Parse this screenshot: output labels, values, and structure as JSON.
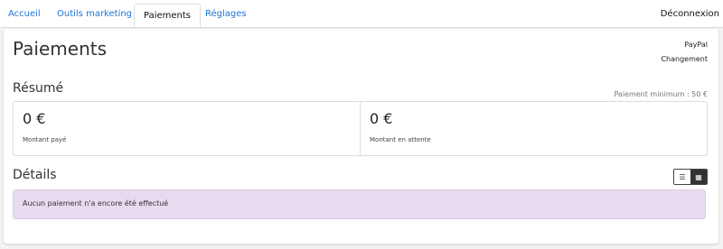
{
  "nav": {
    "tabs": [
      {
        "label": "Accueil"
      },
      {
        "label": "Outils marketing"
      },
      {
        "label": "Paiements"
      },
      {
        "label": "Réglages"
      }
    ],
    "active_tab": "Paiements",
    "logout_label": "Déconnexion"
  },
  "page": {
    "title": "Paiements",
    "paypal_label": "PayPal",
    "change_label": "Changement"
  },
  "summary": {
    "title": "Résumé",
    "min_payment": "Paiement minimum : 50 €",
    "paid": {
      "value": "0 €",
      "label": "Montant payé"
    },
    "pending": {
      "value": "0 €",
      "label": "Montant en attente"
    }
  },
  "details": {
    "title": "Détails",
    "list_icon": "list-icon",
    "grid_icon": "grid-icon",
    "empty_message": "Aucun paiement n'a encore été effectué"
  },
  "colors": {
    "link": "#1f74d8",
    "alert_bg": "#e8dbef",
    "toggle_active": "#333333"
  }
}
